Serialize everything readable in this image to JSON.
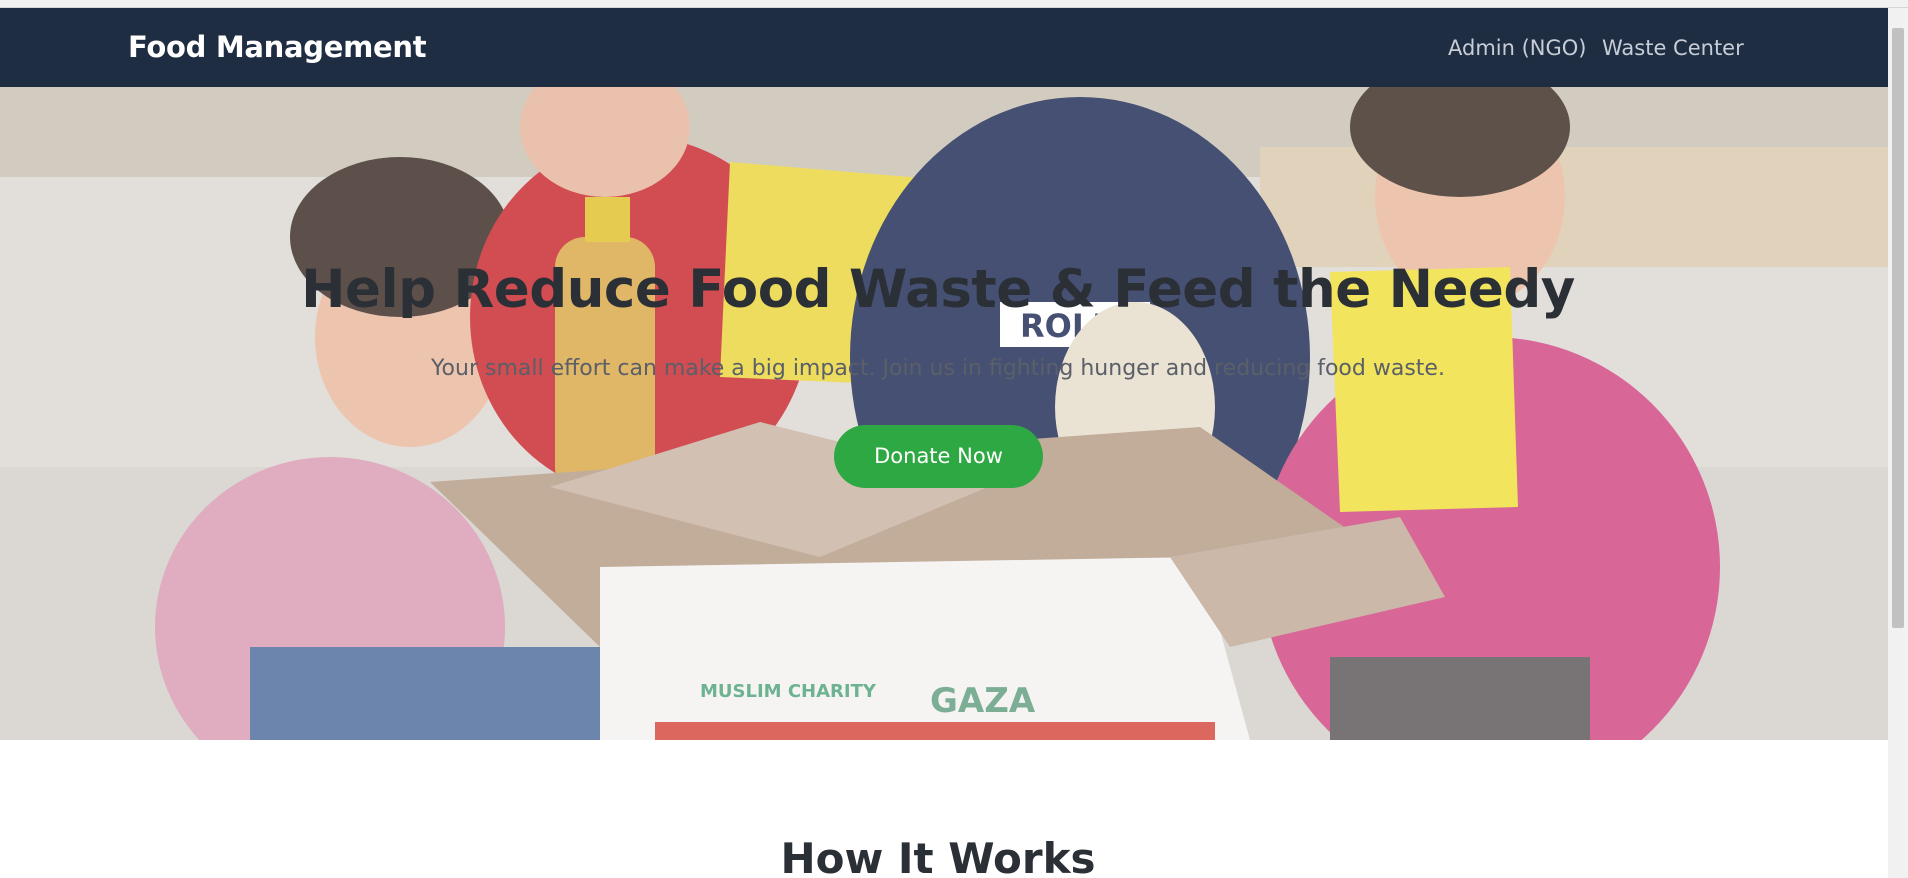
{
  "navbar": {
    "brand": "Food Management",
    "links": [
      {
        "label": "Admin (NGO)"
      },
      {
        "label": "Waste Center"
      }
    ]
  },
  "hero": {
    "title": "Help Reduce Food Waste & Feed the Needy",
    "subtitle": "Your small effort can make a big impact. Join us in fighting hunger and reducing food waste.",
    "cta_label": "Donate Now",
    "image": {
      "box_text_1": "MUSLIM CHARITY",
      "box_text_2": "GAZA",
      "shirt_text": "ROLE"
    }
  },
  "how_it_works": {
    "title": "How It Works"
  },
  "colors": {
    "navbar_bg": "#1f2d42",
    "cta_bg": "#2ea843",
    "title_text": "#2b2f36"
  }
}
